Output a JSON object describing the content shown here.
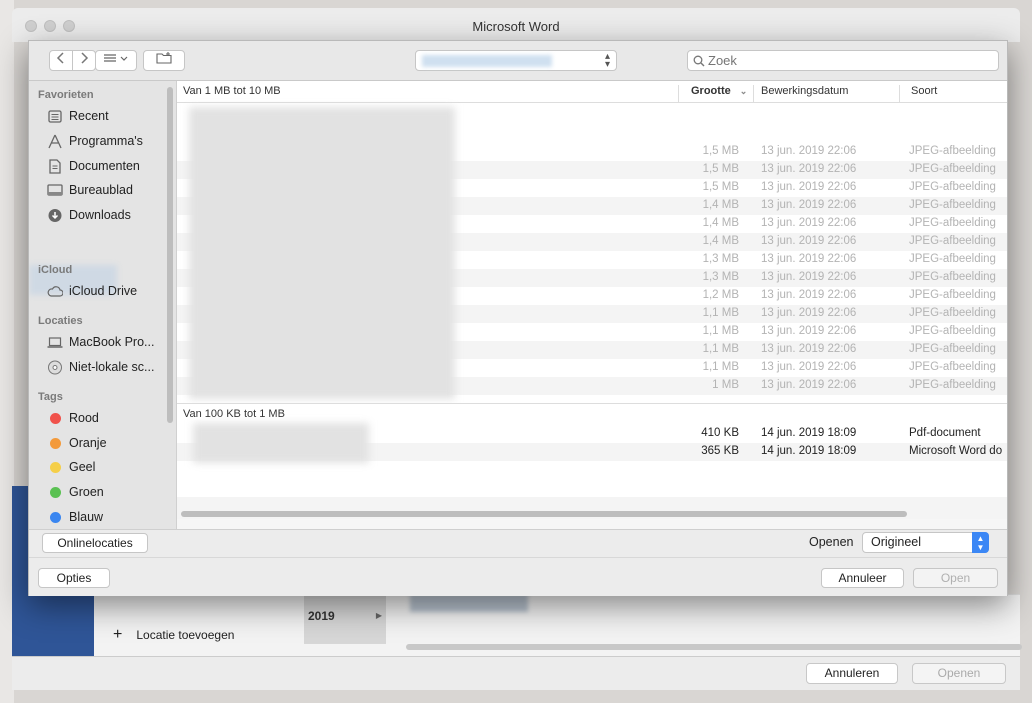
{
  "window": {
    "title": "Microsoft Word"
  },
  "background": {
    "year_label": "2019",
    "add_location": "Locatie toevoegen",
    "cancel_button": "Annuleren",
    "open_button": "Openen"
  },
  "toolbar": {
    "search_placeholder": "Zoek"
  },
  "sidebar": {
    "favorites_header": "Favorieten",
    "favorites": [
      {
        "label": "Recent",
        "icon": "recent-icon"
      },
      {
        "label": "Programma's",
        "icon": "applications-icon"
      },
      {
        "label": "Documenten",
        "icon": "documents-icon"
      },
      {
        "label": "Bureaublad",
        "icon": "desktop-icon"
      },
      {
        "label": "Downloads",
        "icon": "downloads-icon"
      }
    ],
    "icloud_header": "iCloud",
    "icloud": [
      {
        "label": "iCloud Drive",
        "icon": "cloud-icon"
      }
    ],
    "locations_header": "Locaties",
    "locations": [
      {
        "label": "MacBook Pro...",
        "icon": "laptop-icon"
      },
      {
        "label": "Niet-lokale sc...",
        "icon": "disc-icon"
      }
    ],
    "tags_header": "Tags",
    "tags": [
      {
        "label": "Rood",
        "color": "#f0524b"
      },
      {
        "label": "Oranje",
        "color": "#f39a3b"
      },
      {
        "label": "Geel",
        "color": "#f5cf49"
      },
      {
        "label": "Groen",
        "color": "#5ac152"
      },
      {
        "label": "Blauw",
        "color": "#3a86f0"
      }
    ]
  },
  "columns": {
    "size": "Grootte",
    "date": "Bewerkingsdatum",
    "kind": "Soort"
  },
  "groups": [
    {
      "label": "Van 1 MB tot 10 MB",
      "rows": [
        {
          "size": "1,5 MB",
          "date": "13 jun. 2019 22:06",
          "kind": "JPEG-afbeelding"
        },
        {
          "size": "1,5 MB",
          "date": "13 jun. 2019 22:06",
          "kind": "JPEG-afbeelding"
        },
        {
          "size": "1,5 MB",
          "date": "13 jun. 2019 22:06",
          "kind": "JPEG-afbeelding"
        },
        {
          "size": "1,4 MB",
          "date": "13 jun. 2019 22:06",
          "kind": "JPEG-afbeelding"
        },
        {
          "size": "1,4 MB",
          "date": "13 jun. 2019 22:06",
          "kind": "JPEG-afbeelding"
        },
        {
          "size": "1,4 MB",
          "date": "13 jun. 2019 22:06",
          "kind": "JPEG-afbeelding"
        },
        {
          "size": "1,3 MB",
          "date": "13 jun. 2019 22:06",
          "kind": "JPEG-afbeelding"
        },
        {
          "size": "1,3 MB",
          "date": "13 jun. 2019 22:06",
          "kind": "JPEG-afbeelding"
        },
        {
          "size": "1,2 MB",
          "date": "13 jun. 2019 22:06",
          "kind": "JPEG-afbeelding"
        },
        {
          "size": "1,1 MB",
          "date": "13 jun. 2019 22:06",
          "kind": "JPEG-afbeelding"
        },
        {
          "size": "1,1 MB",
          "date": "13 jun. 2019 22:06",
          "kind": "JPEG-afbeelding"
        },
        {
          "size": "1,1 MB",
          "date": "13 jun. 2019 22:06",
          "kind": "JPEG-afbeelding"
        },
        {
          "size": "1,1 MB",
          "date": "13 jun. 2019 22:06",
          "kind": "JPEG-afbeelding"
        },
        {
          "size": "1 MB",
          "date": "13 jun. 2019 22:06",
          "kind": "JPEG-afbeelding"
        }
      ]
    },
    {
      "label": "Van 100 KB tot 1 MB",
      "rows": [
        {
          "size": "410 KB",
          "date": "14 jun. 2019 18:09",
          "kind": "Pdf-document"
        },
        {
          "size": "365 KB",
          "date": "14 jun. 2019 18:09",
          "kind": "Microsoft Word do"
        }
      ]
    }
  ],
  "bottom": {
    "online_locations": "Onlinelocaties",
    "open_label": "Openen",
    "format_value": "Origineel",
    "options": "Opties",
    "cancel": "Annuleer",
    "open": "Open"
  }
}
